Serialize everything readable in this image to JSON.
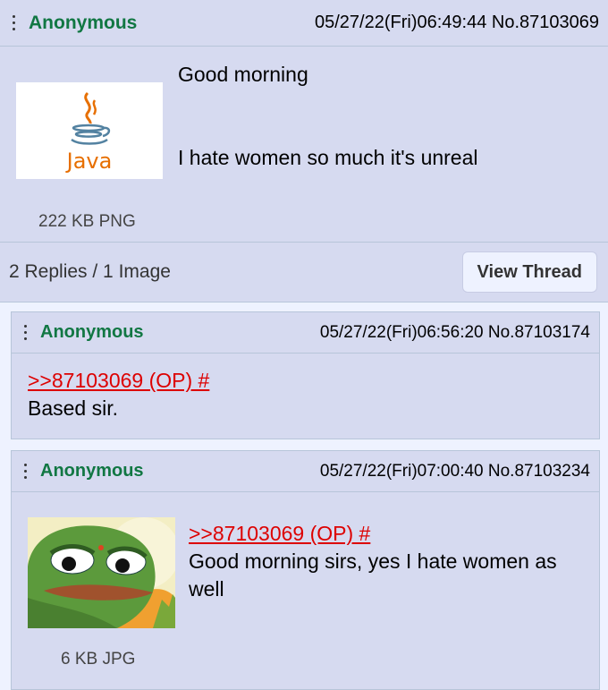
{
  "op": {
    "name": "Anonymous",
    "datetime": "05/27/22(Fri)06:49:44",
    "number": "No.87103069",
    "image_label": "Java",
    "file_info": "222 KB PNG",
    "line1": "Good morning",
    "line2": "I hate women so much it's unreal",
    "counts": "2 Replies / 1 Image",
    "view_thread": "View Thread"
  },
  "replies": [
    {
      "name": "Anonymous",
      "datetime": "05/27/22(Fri)06:56:20",
      "number": "No.87103174",
      "quote": ">>87103069 (OP) #",
      "text": "Based sir."
    },
    {
      "name": "Anonymous",
      "datetime": "05/27/22(Fri)07:00:40",
      "number": "No.87103234",
      "quote": ">>87103069 (OP) #",
      "text": "Good morning sirs, yes I hate women as well",
      "file_info": "6 KB JPG"
    }
  ],
  "colors": {
    "post_bg": "#d6daf0",
    "page_bg": "#eef2ff",
    "name": "#117743",
    "quote": "#dd0000",
    "border": "#b7c5d9"
  },
  "icons": [
    "menu-dots-icon",
    "java-logo-icon"
  ]
}
